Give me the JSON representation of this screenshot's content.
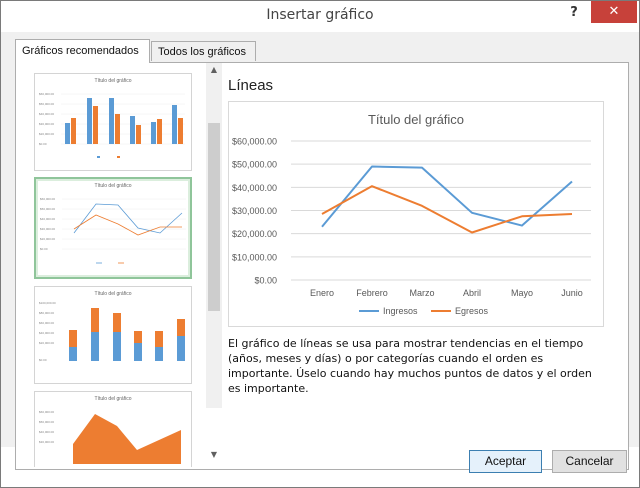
{
  "window": {
    "title": "Insertar gráfico",
    "help_label": "?",
    "close_label": "✕"
  },
  "tabs": [
    {
      "label": "Gráficos recomendados",
      "active": true
    },
    {
      "label": "Todos los gráficos",
      "active": false
    }
  ],
  "thumbnails": [
    {
      "title": "Título del gráfico",
      "kind": "clustered-column"
    },
    {
      "title": "Título del gráfico",
      "kind": "line"
    },
    {
      "title": "Título del gráfico",
      "kind": "stacked-column"
    },
    {
      "title": "Título del gráfico",
      "kind": "area"
    }
  ],
  "selected_chart": {
    "name": "Líneas",
    "description": "El gráfico de líneas se usa para mostrar tendencias en el tiempo (años, meses y días) o por categorías cuando el orden es importante. Úselo cuando hay muchos puntos de datos y el orden es importante."
  },
  "chart_data": {
    "type": "line",
    "title": "Título del gráfico",
    "categories": [
      "Enero",
      "Febrero",
      "Marzo",
      "Abril",
      "Mayo",
      "Junio"
    ],
    "series": [
      {
        "name": "Ingresos",
        "color": "#5b9bd5",
        "values": [
          23000,
          49000,
          48500,
          29000,
          23500,
          42500
        ]
      },
      {
        "name": "Egresos",
        "color": "#ed7d31",
        "values": [
          28500,
          40500,
          32000,
          20500,
          27500,
          28500
        ]
      }
    ],
    "ylim": [
      0,
      60000
    ],
    "yticks": [
      "$0.00",
      "$10,000.00",
      "$20,000.00",
      "$30,000.00",
      "$40,000.00",
      "$50,000.00",
      "$60,000.00"
    ],
    "grid": true,
    "legend_position": "bottom"
  },
  "buttons": {
    "accept": "Aceptar",
    "cancel": "Cancelar"
  },
  "colors": {
    "accent_blue": "#5b9bd5",
    "accent_orange": "#ed7d31",
    "selected_border": "#8fc59a",
    "close_red": "#c7413a"
  }
}
